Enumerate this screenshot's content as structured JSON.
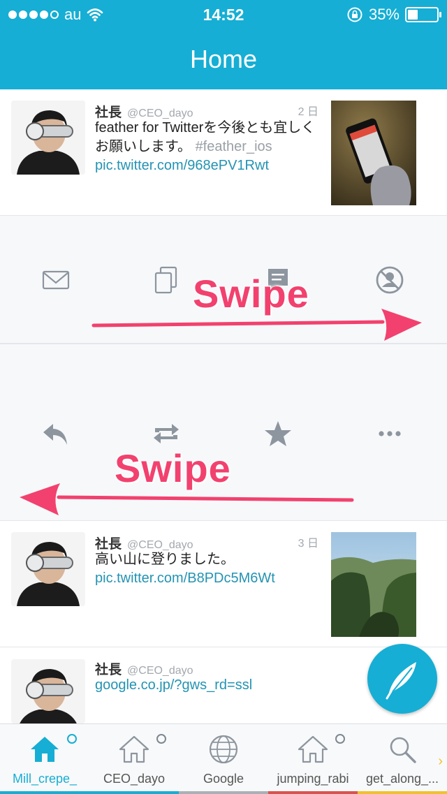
{
  "status_bar": {
    "carrier": "au",
    "time": "14:52",
    "battery": "35%",
    "battery_level": 0.35,
    "signal_filled": 4,
    "signal_total": 5
  },
  "nav": {
    "title": "Home"
  },
  "tweets": [
    {
      "name": "社長",
      "handle": "@CEO_dayo",
      "date": "2 日",
      "text_line1": "feather for Twitterを今後とも宜しく",
      "text_line2": "お願いします。",
      "hashtag": "#feather_ios",
      "link": "pic.twitter.com/968ePV1Rwt"
    },
    {
      "name": "社長",
      "handle": "@CEO_dayo",
      "date": "3 日",
      "text": "高い山に登りました。",
      "link": "pic.twitter.com/B8PDc5M6Wt"
    },
    {
      "name": "社長",
      "handle": "@CEO_dayo",
      "link": "google.co.jp/?gws_rd=ssl"
    }
  ],
  "swipe_labels": {
    "top": "Swipe",
    "bottom": "Swipe"
  },
  "icons": {
    "panel1": [
      "mail-icon",
      "copy-icon",
      "comment-icon",
      "mute-user-icon"
    ],
    "panel2": [
      "reply-icon",
      "retweet-icon",
      "favorite-star-icon",
      "more-dots-icon"
    ],
    "fab": "feather-compose-icon"
  },
  "colors": {
    "accent": "#16aed4",
    "swipe": "#f2416e",
    "icon_gray": "#8d959e",
    "link": "#2393b3"
  },
  "tabs": [
    {
      "label": "Mill_crepe_",
      "icon": "home-icon",
      "color": "#16aed4",
      "active": true
    },
    {
      "label": "CEO_dayo",
      "icon": "home-outline-icon",
      "color": "#16aed4",
      "active": false
    },
    {
      "label": "Google",
      "icon": "globe-icon",
      "color": "#aab0b6",
      "active": false
    },
    {
      "label": "jumping_rabi",
      "icon": "home-outline-icon",
      "color": "#d9534f",
      "active": false
    },
    {
      "label": "get_along_...",
      "icon": "search-icon",
      "color": "#f2c12e",
      "active": false
    }
  ]
}
